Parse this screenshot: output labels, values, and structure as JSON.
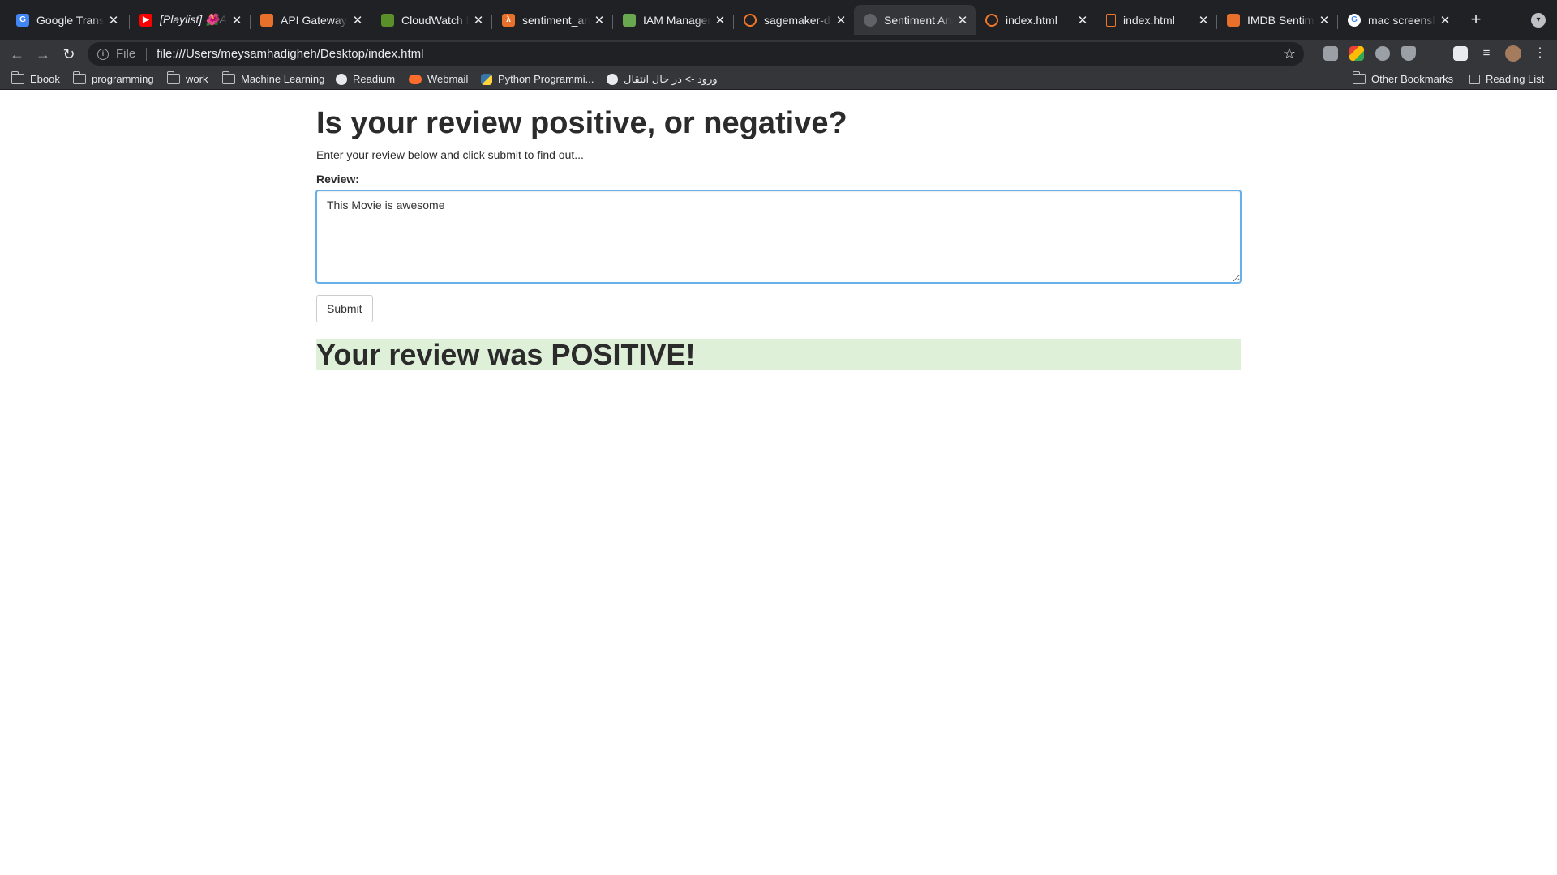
{
  "browser": {
    "tabs": [
      {
        "title": "Google Transla",
        "favicon": "google-translate-icon",
        "color": "#4285f4",
        "active": false
      },
      {
        "title": "[Playlist] 🌺Al",
        "favicon": "youtube-icon",
        "color": "#ff0000",
        "active": false
      },
      {
        "title": "API Gateway",
        "favicon": "aws-api-gateway-icon",
        "color": "#e7712b",
        "active": false
      },
      {
        "title": "CloudWatch M",
        "favicon": "cloudwatch-icon",
        "color": "#5a8f29",
        "active": false
      },
      {
        "title": "sentiment_ana",
        "favicon": "aws-lambda-icon",
        "color": "#e7712b",
        "active": false
      },
      {
        "title": "IAM Managem",
        "favicon": "iam-icon",
        "color": "#6aa84f",
        "active": false
      },
      {
        "title": "sagemaker-de",
        "favicon": "jupyter-icon",
        "color": "#f37726",
        "active": false
      },
      {
        "title": "Sentiment Ana",
        "favicon": "globe-icon",
        "color": "#5f6368",
        "active": true
      },
      {
        "title": "index.html",
        "favicon": "jupyter-icon",
        "color": "#f37726",
        "active": false
      },
      {
        "title": "index.html",
        "favicon": "file-icon",
        "color": "#f37726",
        "active": false
      },
      {
        "title": "IMDB Sentimen",
        "favicon": "book-icon",
        "color": "#e7712b",
        "active": false
      },
      {
        "title": "mac screensho",
        "favicon": "google-icon",
        "color": "#4285f4",
        "active": false
      }
    ],
    "address": {
      "scheme": "File",
      "url": "file:///Users/meysamhadigheh/Desktop/index.html"
    },
    "bookmarks": [
      {
        "label": "Ebook",
        "icon": "folder-icon"
      },
      {
        "label": "programming",
        "icon": "folder-icon"
      },
      {
        "label": "work",
        "icon": "folder-icon"
      },
      {
        "label": "Machine Learning",
        "icon": "folder-icon"
      },
      {
        "label": "Readium",
        "icon": "globe-icon"
      },
      {
        "label": "Webmail",
        "icon": "cpanel-icon"
      },
      {
        "label": "Python Programmi...",
        "icon": "python-icon"
      },
      {
        "label": "ورود -> در حال انتقال",
        "icon": "globe-icon"
      }
    ],
    "other_bookmarks": "Other Bookmarks",
    "reading_list": "Reading List"
  },
  "page": {
    "heading": "Is your review positive, or negative?",
    "lead": "Enter your review below and click submit to find out...",
    "review_label": "Review:",
    "review_value": "This Movie is awesome",
    "submit_label": "Submit",
    "result_text": "Your review was POSITIVE!",
    "result_color": "#dff0d8"
  }
}
